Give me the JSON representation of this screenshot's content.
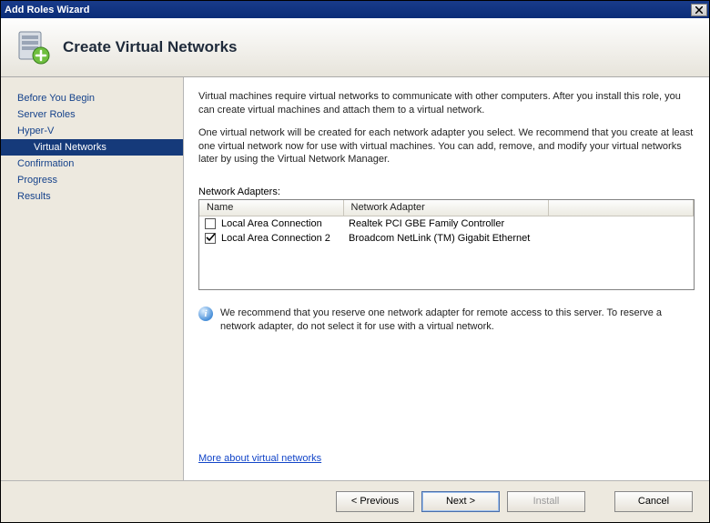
{
  "window": {
    "title": "Add Roles Wizard"
  },
  "header": {
    "title": "Create Virtual Networks"
  },
  "sidebar": {
    "items": [
      {
        "label": "Before You Begin",
        "indent": false,
        "selected": false
      },
      {
        "label": "Server Roles",
        "indent": false,
        "selected": false
      },
      {
        "label": "Hyper-V",
        "indent": false,
        "selected": false
      },
      {
        "label": "Virtual Networks",
        "indent": true,
        "selected": true
      },
      {
        "label": "Confirmation",
        "indent": false,
        "selected": false
      },
      {
        "label": "Progress",
        "indent": false,
        "selected": false
      },
      {
        "label": "Results",
        "indent": false,
        "selected": false
      }
    ]
  },
  "main": {
    "intro1": "Virtual machines require virtual networks to communicate with other computers. After you install this role, you can create virtual machines and attach them to a virtual network.",
    "intro2": "One virtual network will be created for each network adapter you select. We recommend that you create at least one virtual network now for use with virtual machines. You can add, remove, and modify your virtual networks later by using the Virtual Network Manager.",
    "adapters_label": "Network Adapters:",
    "grid": {
      "col_name": "Name",
      "col_adapter": "Network Adapter",
      "rows": [
        {
          "checked": false,
          "name": "Local Area Connection",
          "adapter": "Realtek PCI GBE Family Controller"
        },
        {
          "checked": true,
          "name": "Local Area Connection 2",
          "adapter": "Broadcom NetLink (TM) Gigabit Ethernet"
        }
      ]
    },
    "info_text": "We recommend that you reserve one network adapter for remote access to this server. To reserve a network adapter, do not select it for use with a virtual network.",
    "link_text": "More about virtual networks"
  },
  "footer": {
    "previous": "< Previous",
    "next": "Next >",
    "install": "Install",
    "cancel": "Cancel"
  }
}
